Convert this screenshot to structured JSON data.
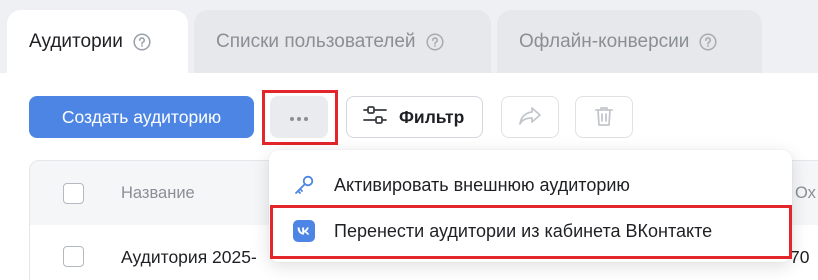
{
  "tabs": [
    {
      "label": "Аудитории",
      "active": true,
      "icon": "help-circle-icon"
    },
    {
      "label": "Списки пользователей",
      "active": false,
      "icon": "help-circle-icon"
    },
    {
      "label": "Офлайн-конверсии",
      "active": false,
      "icon": "help-circle-icon"
    }
  ],
  "toolbar": {
    "create_label": "Создать аудиторию",
    "more_icon": "more-dots-icon",
    "filter_label": "Фильтр",
    "filter_icon": "sliders-icon",
    "share_icon": "share-arrow-icon",
    "trash_icon": "trash-icon"
  },
  "table": {
    "columns": [
      "Название",
      "Ох"
    ],
    "rows": [
      {
        "name": "Аудитория 2025-",
        "right": "70"
      }
    ]
  },
  "menu": {
    "items": [
      {
        "label": "Активировать внешнюю аудиторию",
        "icon": "key-icon"
      },
      {
        "label": "Перенести аудитории из кабинета ВКонтакте",
        "icon": "vk-logo-icon"
      }
    ]
  },
  "colors": {
    "accent": "#4c85e3",
    "highlight": "#e3262b",
    "vk": "#4c85e3"
  }
}
